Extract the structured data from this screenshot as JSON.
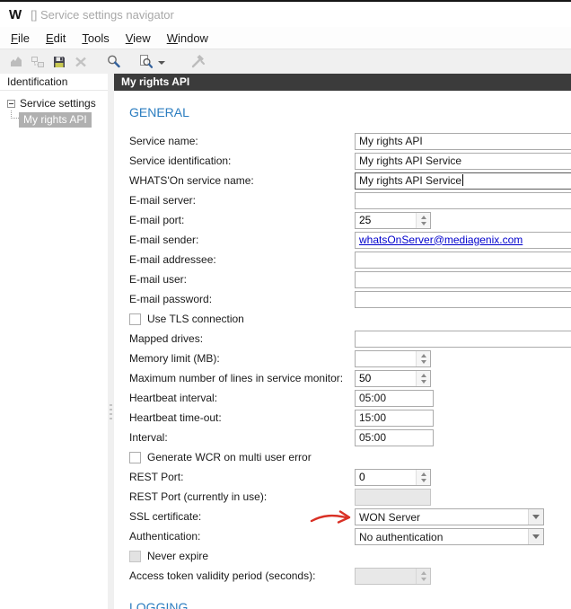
{
  "window": {
    "logo": "W",
    "title": "[] Service settings navigator"
  },
  "menu": {
    "items": [
      {
        "mnemonic": "F",
        "rest": "ile"
      },
      {
        "mnemonic": "E",
        "rest": "dit"
      },
      {
        "mnemonic": "T",
        "rest": "ools"
      },
      {
        "mnemonic": "V",
        "rest": "iew"
      },
      {
        "mnemonic": "W",
        "rest": "indow"
      }
    ]
  },
  "toolbar": {
    "buttons": [
      {
        "name": "import-chart",
        "enabled": false
      },
      {
        "name": "hierarchy",
        "enabled": false
      },
      {
        "name": "save",
        "enabled": true
      },
      {
        "name": "delete",
        "enabled": false
      },
      {
        "name": "search",
        "enabled": true
      },
      {
        "name": "search-document",
        "enabled": true,
        "has_dropdown": true
      },
      {
        "name": "tools",
        "enabled": false
      }
    ]
  },
  "sidebar": {
    "header": "Identification",
    "root_node": "Service settings",
    "selected_node": "My rights API"
  },
  "main": {
    "header": "My rights API",
    "section_general": "GENERAL",
    "section_logging": "LOGGING"
  },
  "form": {
    "rows": [
      {
        "label": "Service name:",
        "value": "My rights API"
      },
      {
        "label": "Service identification:",
        "value": "My rights API Service"
      },
      {
        "label": "WHATS'On service name:",
        "value": "My rights API Service"
      },
      {
        "label": "E-mail server:",
        "value": ""
      },
      {
        "label": "E-mail port:",
        "value": "25"
      },
      {
        "label": "E-mail sender:",
        "value": "whatsOnServer@mediagenix.com"
      },
      {
        "label": "E-mail addressee:",
        "value": ""
      },
      {
        "label": "E-mail user:",
        "value": ""
      },
      {
        "label": "E-mail password:",
        "value": ""
      },
      {
        "label": "Use TLS connection",
        "checked": false
      },
      {
        "label": "Mapped drives:",
        "value": ""
      },
      {
        "label": "Memory limit (MB):",
        "value": ""
      },
      {
        "label": "Maximum number of lines in service monitor:",
        "value": "50"
      },
      {
        "label": "Heartbeat interval:",
        "value": "05:00"
      },
      {
        "label": "Heartbeat time-out:",
        "value": "15:00"
      },
      {
        "label": "Interval:",
        "value": "05:00"
      },
      {
        "label": "Generate WCR on multi user error",
        "checked": false
      },
      {
        "label": "REST Port:",
        "value": "0"
      },
      {
        "label": "REST Port (currently in use):",
        "value": "",
        "disabled": true
      },
      {
        "label": "SSL certificate:",
        "value": "WON Server"
      },
      {
        "label": "Authentication:",
        "value": "No authentication"
      },
      {
        "label": "Never expire",
        "checked": false,
        "disabled": true
      },
      {
        "label": "Access token validity period (seconds):",
        "value": "",
        "disabled": true
      }
    ]
  },
  "annotation": {
    "type": "hand-drawn-arrow",
    "points_to": "SSL certificate dropdown",
    "color": "#d93025"
  },
  "colors": {
    "header_bar": "#3b3b3b",
    "section_heading": "#2b7dc0",
    "link": "#0000cc",
    "selected_tree_item_bg": "#b0b0b0",
    "annotation_arrow": "#d93025"
  }
}
